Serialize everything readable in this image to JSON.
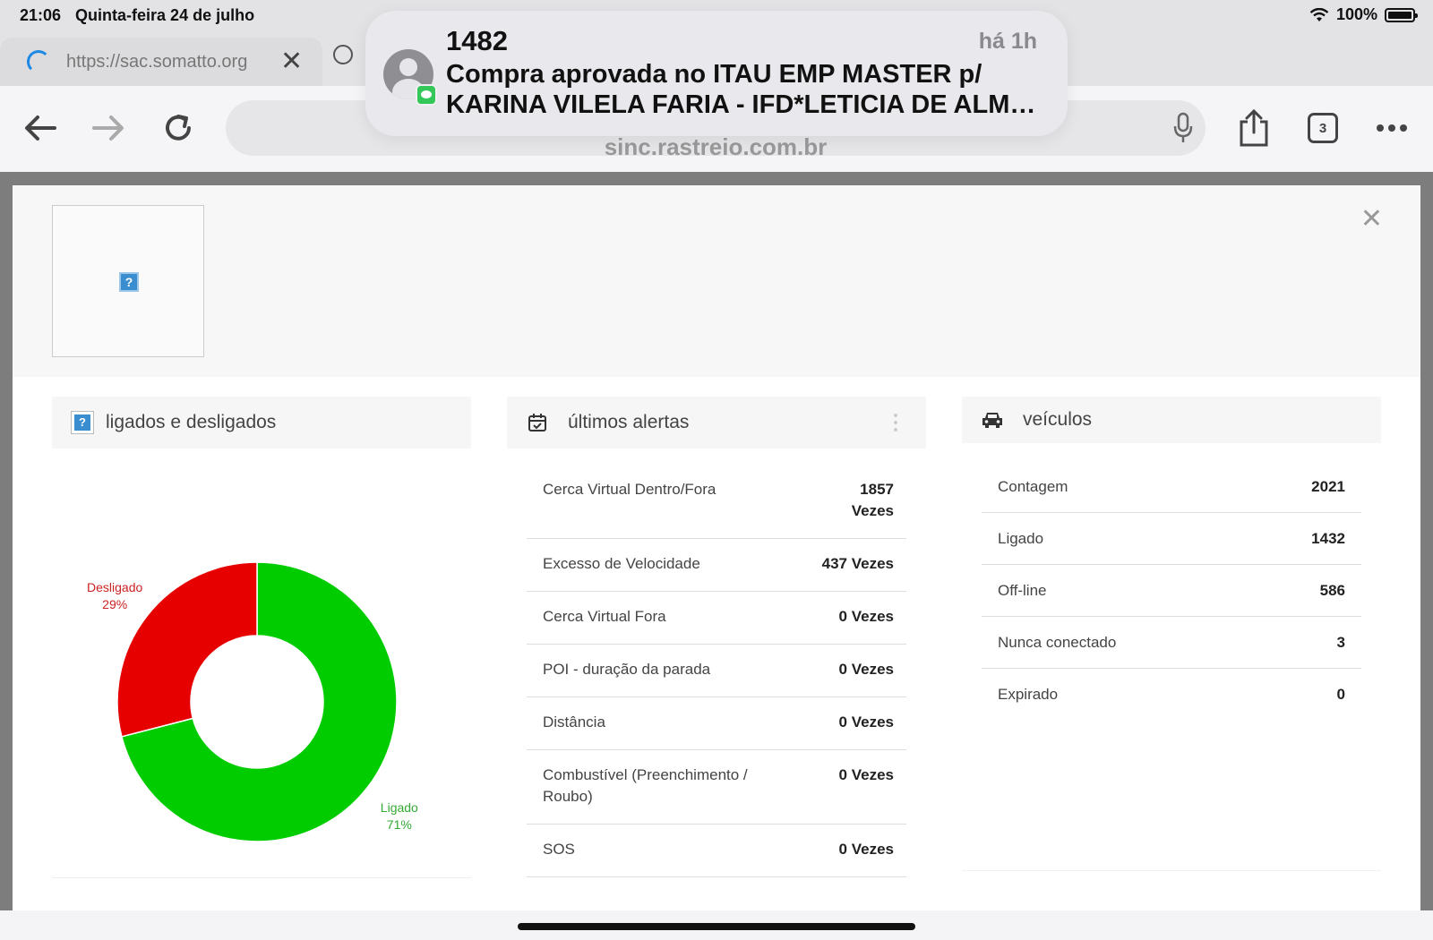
{
  "status_bar": {
    "time": "21:06",
    "date": "Quinta-feira 24 de julho",
    "battery": "100%",
    "battery_level": 1.0
  },
  "browser": {
    "tab_url": "https://sac.somatto.org",
    "address_domain": "sinc.rastreio.com.br",
    "tab_count": "3"
  },
  "notification": {
    "title": "1482",
    "time": "há 1h",
    "line1": "Compra aprovada no ITAU EMP MASTER p/",
    "line2": "KARINA VILELA FARIA - IFD*LETICIA DE ALMEI..."
  },
  "panels": {
    "status": {
      "title": "ligados e desligados"
    },
    "alerts": {
      "title": "últimos alertas",
      "rows": [
        {
          "label": "Cerca Virtual Dentro/Fora",
          "value": "1857 Vezes"
        },
        {
          "label": "Excesso de Velocidade",
          "value": "437 Vezes"
        },
        {
          "label": "Cerca Virtual Fora",
          "value": "0 Vezes"
        },
        {
          "label": "POI - duração da parada",
          "value": "0 Vezes"
        },
        {
          "label": "Distância",
          "value": "0 Vezes"
        },
        {
          "label": "Combustível (Preenchimento / Roubo)",
          "value": "0 Vezes"
        },
        {
          "label": "SOS",
          "value": "0 Vezes"
        }
      ]
    },
    "vehicles": {
      "title": "veículos",
      "rows": [
        {
          "label": "Contagem",
          "value": "2021"
        },
        {
          "label": "Ligado",
          "value": "1432"
        },
        {
          "label": "Off-line",
          "value": "586"
        },
        {
          "label": "Nunca conectado",
          "value": "3"
        },
        {
          "label": "Expirado",
          "value": "0"
        }
      ]
    }
  },
  "chart_data": {
    "type": "pie",
    "donut": true,
    "categories": [
      "Ligado",
      "Desligado"
    ],
    "values": [
      71,
      29
    ],
    "value_labels": [
      "71%",
      "29%"
    ],
    "colors": [
      "#00cc00",
      "#e60000"
    ],
    "label_colors": [
      "#33aa33",
      "#cc2222"
    ]
  },
  "colors": {
    "modal_bg": "#ffffff",
    "overlay": "#7d7d7d",
    "link_blue": "#1e88e5"
  }
}
